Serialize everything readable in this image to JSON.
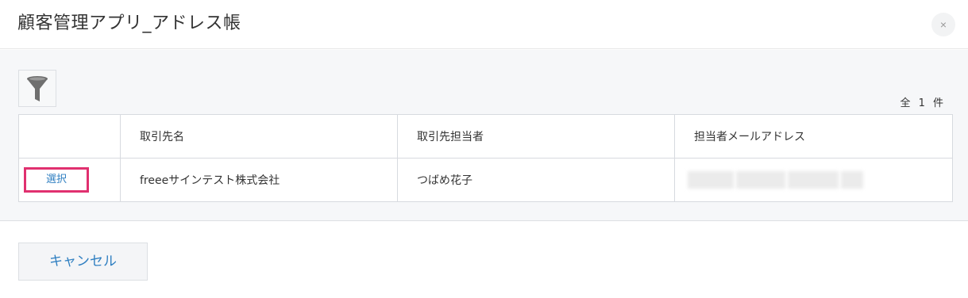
{
  "dialog": {
    "title": "顧客管理アプリ_アドレス帳",
    "close_label": "×"
  },
  "toolbar": {
    "filter_icon": "funnel-icon",
    "record_count": "全 1 件"
  },
  "table": {
    "columns": [
      "",
      "取引先名",
      "取引先担当者",
      "担当者メールアドレス"
    ],
    "rows": [
      {
        "select_label": "選択",
        "company": "freeeサインテスト株式会社",
        "contact": "つばめ花子",
        "email": ""
      }
    ]
  },
  "footer": {
    "cancel_label": "キャンセル"
  },
  "colors": {
    "accent": "#2f7fc1",
    "highlight": "#e0306f",
    "body_bg": "#f6f7f9"
  }
}
